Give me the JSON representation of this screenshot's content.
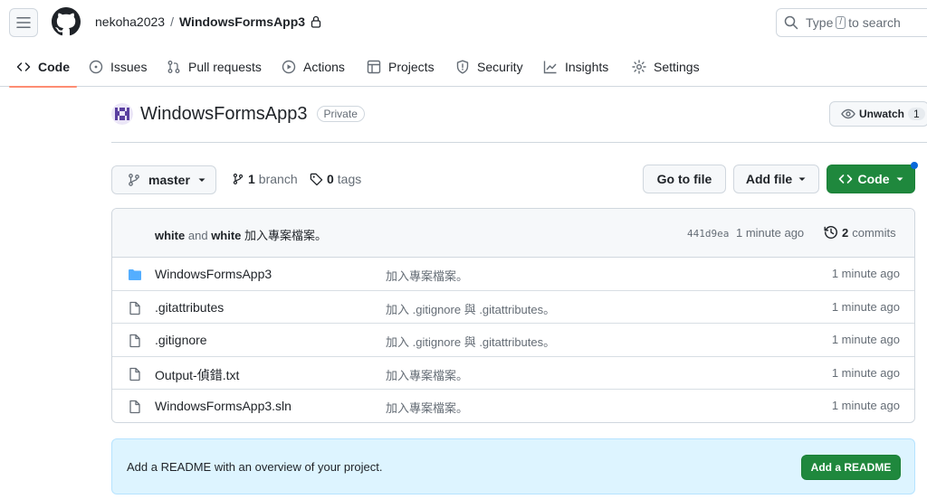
{
  "header": {
    "owner": "nekoha2023",
    "separator": "/",
    "repo": "WindowsFormsApp3",
    "search": {
      "before": "Type",
      "key": "/",
      "after": "to search"
    }
  },
  "tabs": [
    {
      "label": "Code",
      "icon": "code-icon",
      "active": true
    },
    {
      "label": "Issues",
      "icon": "issue-icon"
    },
    {
      "label": "Pull requests",
      "icon": "pull-request-icon"
    },
    {
      "label": "Actions",
      "icon": "play-icon"
    },
    {
      "label": "Projects",
      "icon": "table-icon"
    },
    {
      "label": "Security",
      "icon": "shield-icon"
    },
    {
      "label": "Insights",
      "icon": "graph-icon"
    },
    {
      "label": "Settings",
      "icon": "gear-icon"
    }
  ],
  "repo": {
    "name": "WindowsFormsApp3",
    "visibility": "Private",
    "watch_label": "Unwatch",
    "watch_count": "1"
  },
  "branch": {
    "current": "master",
    "branch_count": "1",
    "branch_label": "branch",
    "tag_count": "0",
    "tag_label": "tags"
  },
  "actions": {
    "go_to_file": "Go to file",
    "add_file": "Add file",
    "code": "Code"
  },
  "latest_commit": {
    "author1": "white",
    "and": "and",
    "author2": "white",
    "message": "加入專案檔案。",
    "sha": "441d9ea",
    "time": "1 minute ago",
    "commit_count": "2",
    "commit_label": "commits"
  },
  "files": [
    {
      "name": "WindowsFormsApp3",
      "type": "folder",
      "message": "加入專案檔案。",
      "time": "1 minute ago"
    },
    {
      "name": ".gitattributes",
      "type": "file",
      "message": "加入 .gitignore 與 .gitattributes。",
      "time": "1 minute ago"
    },
    {
      "name": ".gitignore",
      "type": "file",
      "message": "加入 .gitignore 與 .gitattributes。",
      "time": "1 minute ago"
    },
    {
      "name": "Output-偵錯.txt",
      "type": "file",
      "message": "加入專案檔案。",
      "time": "1 minute ago"
    },
    {
      "name": "WindowsFormsApp3.sln",
      "type": "file",
      "message": "加入專案檔案。",
      "time": "1 minute ago"
    }
  ],
  "readme": {
    "text": "Add a README with an overview of your project.",
    "button": "Add a README"
  },
  "colors": {
    "accent_green": "#1f883d",
    "tab_underline": "#fd8c73",
    "folder_blue": "#54aeff",
    "notification_blue": "#0969da",
    "readme_bg": "#ddf4ff"
  }
}
